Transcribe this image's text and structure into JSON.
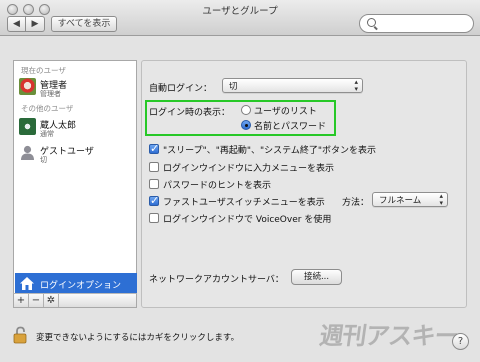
{
  "window": {
    "title": "ユーザとグループ"
  },
  "toolbar": {
    "back": "◀",
    "forward": "▶",
    "show_all": "すべてを表示",
    "search_placeholder": ""
  },
  "sidebar": {
    "current_header": "現在のユーザ",
    "other_header": "その他のユーザ",
    "users": [
      {
        "name": "管理者",
        "role": "管理者"
      },
      {
        "name": "蔵人太郎",
        "role": "通常"
      },
      {
        "name": "ゲストユーザ",
        "role": "切"
      }
    ],
    "login_options": "ログインオプション",
    "add": "+",
    "remove": "−",
    "gear": "✲"
  },
  "settings": {
    "auto_login_label": "自動ログイン：",
    "auto_login_value": "切",
    "display_label": "ログイン時の表示：",
    "radio_list": "ユーザのリスト",
    "radio_name_password": "名前とパスワード",
    "radio_selected": "名前とパスワード",
    "checkboxes": [
      {
        "label": "\"スリープ\"、\"再起動\"、\"システム終了\"ボタンを表示",
        "checked": true
      },
      {
        "label": "ログインウインドウに入力メニューを表示",
        "checked": false
      },
      {
        "label": "パスワードのヒントを表示",
        "checked": false
      },
      {
        "label": "ファストユーザスイッチメニューを表示",
        "checked": true
      },
      {
        "label": "ログインウインドウで VoiceOver を使用",
        "checked": false
      }
    ],
    "method_label": "方法：",
    "method_value": "フルネーム",
    "network_label": "ネットワークアカウントサーバ：",
    "join_button": "接続..."
  },
  "footer": {
    "lock_text": "変更できないようにするにはカギをクリックします。",
    "watermark": "週刊アスキー",
    "help": "?"
  },
  "colors": {
    "selection": "#2d6fd4",
    "highlight_box": "#27c827",
    "checkbox_on": "#2f6dd2"
  }
}
